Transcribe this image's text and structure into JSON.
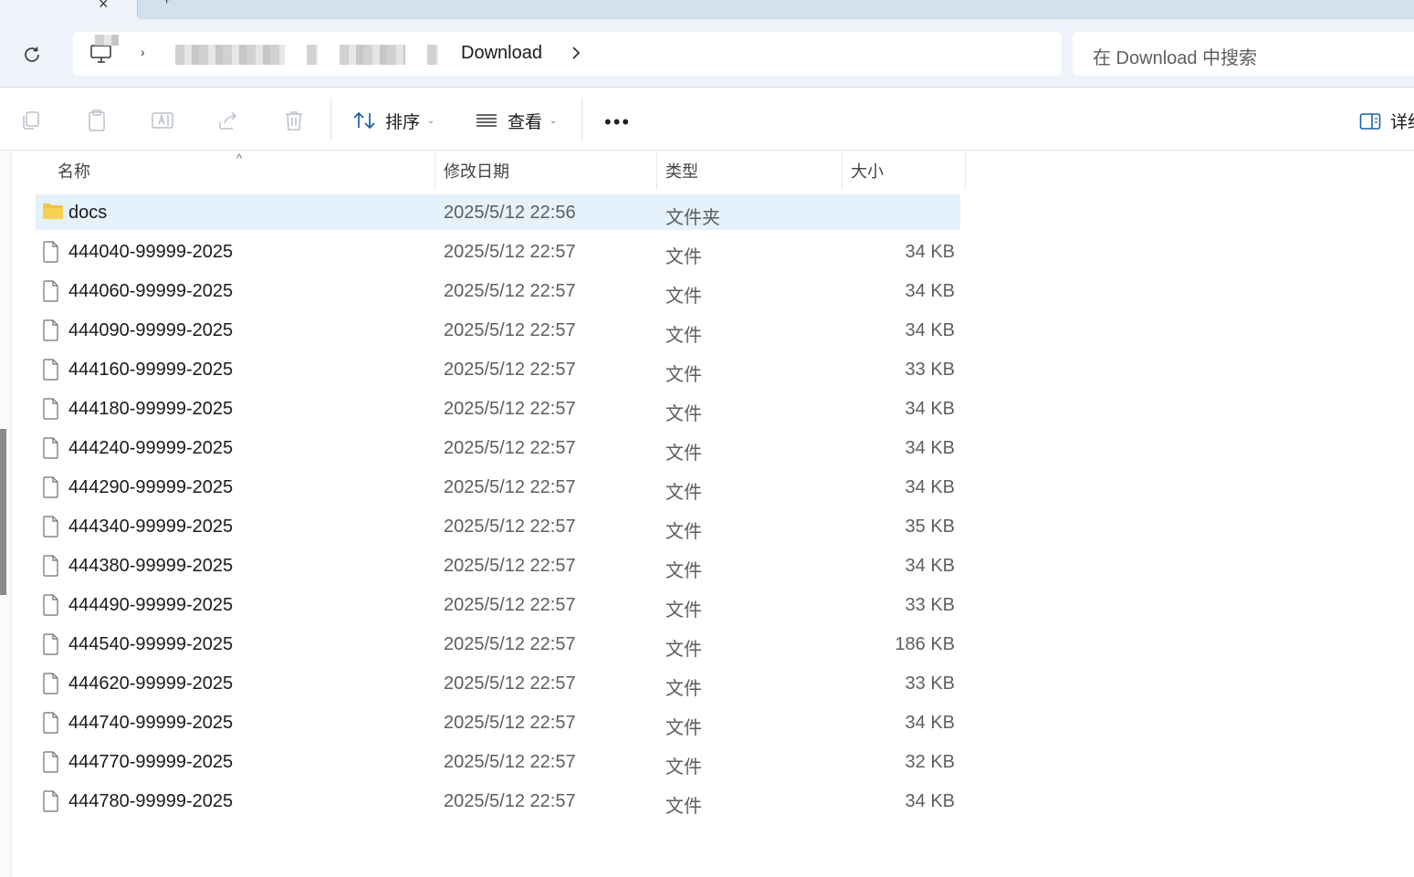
{
  "tabs": {
    "close_glyph": "×",
    "new_glyph": "+"
  },
  "address": {
    "current_folder": "Download",
    "search_placeholder": "在 Download 中搜索"
  },
  "toolbar": {
    "sort_label": "排序",
    "view_label": "查看",
    "more_label": "•••",
    "details_label": "详细"
  },
  "columns": {
    "name": "名称",
    "date": "修改日期",
    "type": "类型",
    "size": "大小"
  },
  "files": [
    {
      "name": "docs",
      "date": "2025/5/12 22:56",
      "type": "文件夹",
      "size": "",
      "kind": "folder"
    },
    {
      "name": "444040-99999-2025",
      "date": "2025/5/12 22:57",
      "type": "文件",
      "size": "34 KB",
      "kind": "file"
    },
    {
      "name": "444060-99999-2025",
      "date": "2025/5/12 22:57",
      "type": "文件",
      "size": "34 KB",
      "kind": "file"
    },
    {
      "name": "444090-99999-2025",
      "date": "2025/5/12 22:57",
      "type": "文件",
      "size": "34 KB",
      "kind": "file"
    },
    {
      "name": "444160-99999-2025",
      "date": "2025/5/12 22:57",
      "type": "文件",
      "size": "33 KB",
      "kind": "file"
    },
    {
      "name": "444180-99999-2025",
      "date": "2025/5/12 22:57",
      "type": "文件",
      "size": "34 KB",
      "kind": "file"
    },
    {
      "name": "444240-99999-2025",
      "date": "2025/5/12 22:57",
      "type": "文件",
      "size": "34 KB",
      "kind": "file"
    },
    {
      "name": "444290-99999-2025",
      "date": "2025/5/12 22:57",
      "type": "文件",
      "size": "34 KB",
      "kind": "file"
    },
    {
      "name": "444340-99999-2025",
      "date": "2025/5/12 22:57",
      "type": "文件",
      "size": "35 KB",
      "kind": "file"
    },
    {
      "name": "444380-99999-2025",
      "date": "2025/5/12 22:57",
      "type": "文件",
      "size": "34 KB",
      "kind": "file"
    },
    {
      "name": "444490-99999-2025",
      "date": "2025/5/12 22:57",
      "type": "文件",
      "size": "33 KB",
      "kind": "file"
    },
    {
      "name": "444540-99999-2025",
      "date": "2025/5/12 22:57",
      "type": "文件",
      "size": "186 KB",
      "kind": "file"
    },
    {
      "name": "444620-99999-2025",
      "date": "2025/5/12 22:57",
      "type": "文件",
      "size": "33 KB",
      "kind": "file"
    },
    {
      "name": "444740-99999-2025",
      "date": "2025/5/12 22:57",
      "type": "文件",
      "size": "34 KB",
      "kind": "file"
    },
    {
      "name": "444770-99999-2025",
      "date": "2025/5/12 22:57",
      "type": "文件",
      "size": "32 KB",
      "kind": "file"
    },
    {
      "name": "444780-99999-2025",
      "date": "2025/5/12 22:57",
      "type": "文件",
      "size": "34 KB",
      "kind": "file"
    }
  ],
  "colors": {
    "selection": "#e5f1fb",
    "folder": "#f4c443",
    "accent": "#005fb8"
  }
}
